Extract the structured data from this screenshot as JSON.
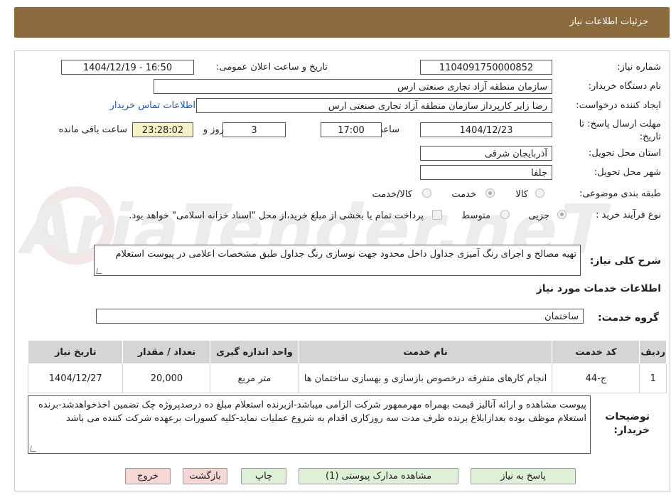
{
  "header": {
    "title": "جزئیات اطلاعات نیاز"
  },
  "form": {
    "need_number_label": "شماره نیاز:",
    "need_number": "1104091750000852",
    "announce_label": "تاریخ و ساعت اعلان عمومی:",
    "announce_value": "1404/12/19 - 16:50",
    "buyer_org_label": "نام دستگاه خریدار:",
    "buyer_org": "سازمان منطقه آزاد تجاری صنعتی ارس",
    "creator_label": "ایجاد کننده درخواست:",
    "creator": "رضا زایر کارپرداز سازمان منطقه آزاد تجاری صنعتی ارس",
    "contact_link": "اطلاعات تماس خریدار",
    "deadline_label_1": "مهلت ارسال پاسخ: تا",
    "deadline_label_2": "تاریخ:",
    "deadline_date": "1404/12/23",
    "time_label": "ساعت",
    "deadline_time": "17:00",
    "days_value": "3",
    "days_label": "روز و",
    "remaining_time": "23:28:02",
    "remaining_label": "ساعت باقی مانده",
    "province_label": "استان محل تحویل:",
    "province": "آذربایجان شرقی",
    "city_label": "شهر محل تحویل:",
    "city": "جلفا",
    "category_label": "طبقه بندی موضوعی:",
    "category_options": [
      "کالا",
      "خدمت",
      "کالا/خدمت"
    ],
    "purchase_type_label": "نوع فرآیند خرید :",
    "purchase_options": [
      "جزیی",
      "متوسط"
    ],
    "purchase_note": "پرداخت تمام یا بخشی از مبلغ خرید،از محل \"اسناد خزانه اسلامی\" خواهد بود.",
    "description_label": "شرح کلی نیاز:",
    "description": "تهیه مصالح و اجرای رنگ آمیزی جداول داخل محدود جهت نوسازی رنگ جداول طبق مشخصات اعلامی در پیوست استعلام",
    "services_title": "اطلاعات خدمات مورد نیاز",
    "service_group_label": "گروه خدمت:",
    "service_group": "ساختمان"
  },
  "table": {
    "headers": [
      "ردیف",
      "کد خدمت",
      "نام خدمت",
      "واحد اندازه گیری",
      "تعداد / مقدار",
      "تاریخ نیاز"
    ],
    "rows": [
      [
        "1",
        "ج-44",
        "انجام کارهای متفرقه درخصوص بازسازی و بهسازی ساختمان ها",
        "متر مربع",
        "20,000",
        "1404/12/27"
      ]
    ]
  },
  "buyer_notes": {
    "label_1": "توضیحات",
    "label_2": "خریدار:",
    "text": "پیوست مشاهده و ارائه آنالیز قیمت بهمراه مهرممهور شرکت الزامی میباشد-ازبرنده استعلام مبلغ ده درصدپروژه چک تضمین اخذخواهدشد-برنده استعلام موظف بوده بعدازابلاغ برنده ظرف مدت سه روزکاری اقدام به شروع عملیات نماید-کلیه کسورات برعهده شرکت کننده می باشد"
  },
  "buttons": {
    "reply": "پاسخ به نیاز",
    "attachments": "مشاهده مدارک پیوستی (1)",
    "print": "چاپ",
    "back": "بازگشت",
    "exit": "خروج"
  },
  "watermark": "AriaTender.neT",
  "colors": {
    "header_bg": "#8b6a3e",
    "link": "#1b56b5",
    "remaining_bg": "#f5f0c6",
    "btn_green": "#dff0d8",
    "btn_red": "#f7d6d6"
  }
}
